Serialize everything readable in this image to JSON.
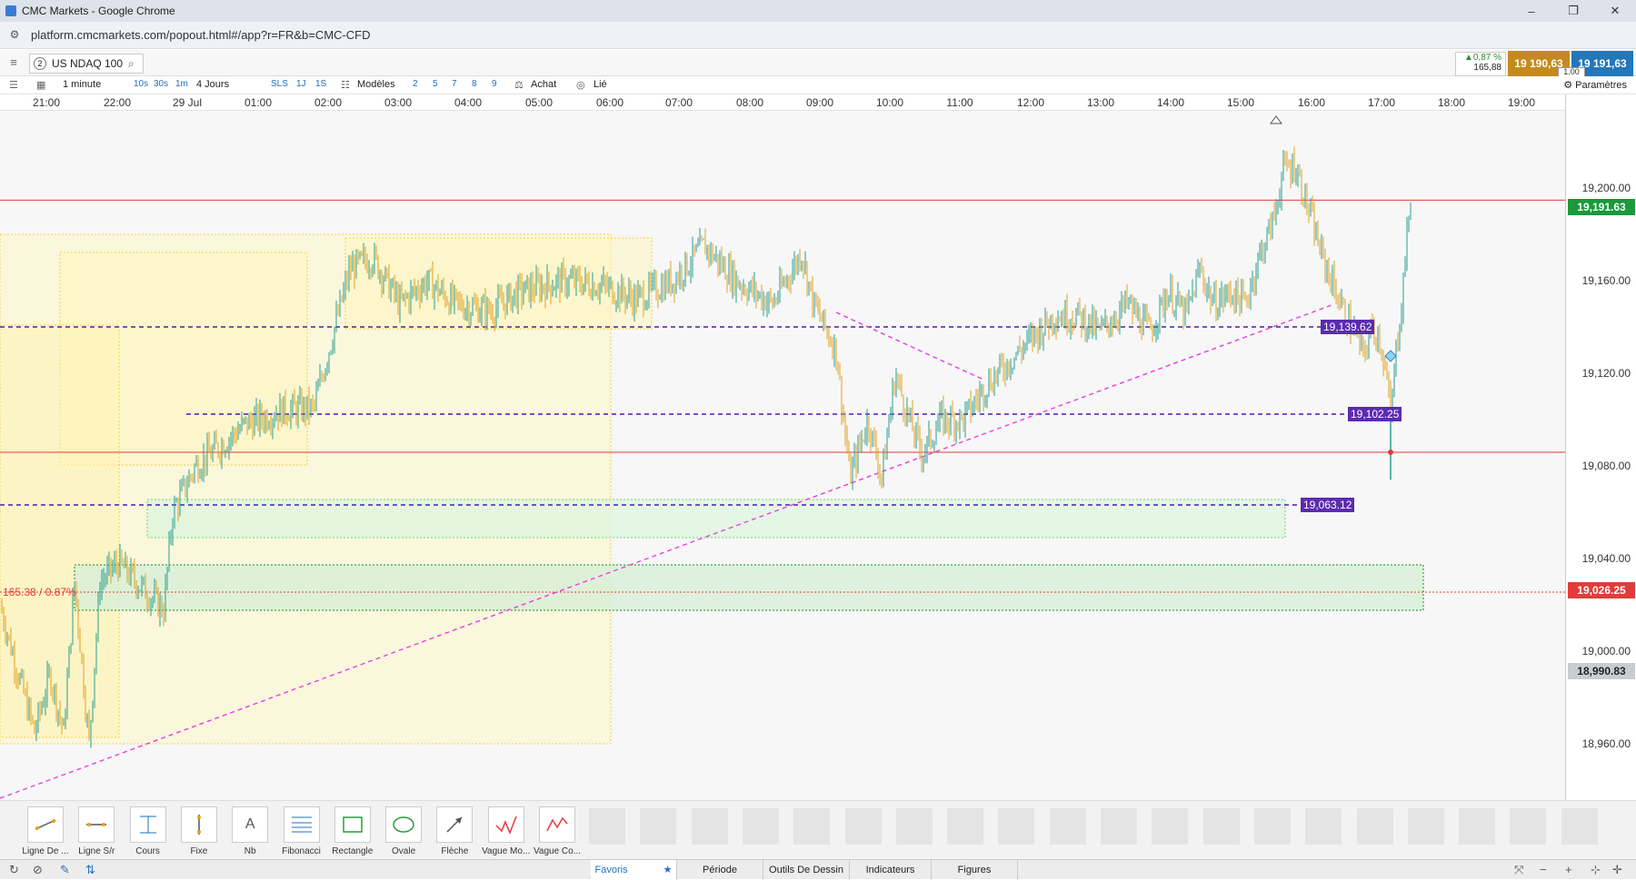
{
  "window": {
    "title": "CMC Markets - Google Chrome",
    "controls": [
      "–",
      "❐",
      "✕"
    ]
  },
  "browser": {
    "url": "platform.cmcmarkets.com/popout.html#/app?r=FR&b=CMC-CFD"
  },
  "instrument": {
    "slot": "2",
    "name": "US NDAQ 100"
  },
  "quote": {
    "change_pct": "▲0,87 %",
    "change_pts": "165,88",
    "sell": "19 190,63",
    "buy": "19 191,63",
    "spread": "1.00"
  },
  "toolbar": {
    "interval": "1 minute",
    "intervals": [
      "10s",
      "30s",
      "1m"
    ],
    "range": "4 Jours",
    "ranges": [
      "SLS",
      "1J",
      "1S"
    ],
    "templates": "Modèles",
    "template_slots": [
      "2",
      "5",
      "7",
      "8",
      "9"
    ],
    "buy_label": "Achat",
    "link_label": "Lié",
    "settings_label": "Paramètres"
  },
  "time_axis": [
    "21:00",
    "22:00",
    "29 Jul",
    "01:00",
    "02:00",
    "03:00",
    "04:00",
    "05:00",
    "06:00",
    "07:00",
    "08:00",
    "09:00",
    "10:00",
    "11:00",
    "12:00",
    "13:00",
    "14:00",
    "15:00",
    "16:00",
    "17:00",
    "18:00",
    "19:00"
  ],
  "price_axis": [
    "19,200.00",
    "19,160.00",
    "19,120.00",
    "19,080.00",
    "19,040.00",
    "19,000.00",
    "18,960.00"
  ],
  "price_tags": {
    "current": "19,191.63",
    "reference": "19,026.25",
    "low": "18,990.83"
  },
  "horizontal_lines": [
    "19,139.62",
    "19,102.25",
    "19,063.12"
  ],
  "chart_note": "165.38 / 0.87%",
  "colors": {
    "up": "#2a9d8f",
    "down": "#e0a020",
    "line_tag": "#5b2bb0",
    "current": "#1a9a3a",
    "red": "#e23b3b"
  },
  "drawing_tools": [
    {
      "label": "Ligne De ...",
      "icon": "trend-line-icon"
    },
    {
      "label": "Ligne S/r",
      "icon": "horizontal-line-icon"
    },
    {
      "label": "Cours",
      "icon": "price-icon"
    },
    {
      "label": "Fixe",
      "icon": "vertical-line-icon"
    },
    {
      "label": "Nb",
      "icon": "text-icon",
      "glyph": "A"
    },
    {
      "label": "Fibonacci",
      "icon": "fibonacci-icon"
    },
    {
      "label": "Rectangle",
      "icon": "rectangle-icon"
    },
    {
      "label": "Ovale",
      "icon": "oval-icon"
    },
    {
      "label": "Flèche",
      "icon": "arrow-icon"
    },
    {
      "label": "Vague Mo...",
      "icon": "wave-icon"
    },
    {
      "label": "Vague Co...",
      "icon": "corrective-wave-icon"
    }
  ],
  "bottom_tabs": [
    "Favoris",
    "Période",
    "Outils De Dessin",
    "Indicateurs",
    "Figures"
  ]
}
